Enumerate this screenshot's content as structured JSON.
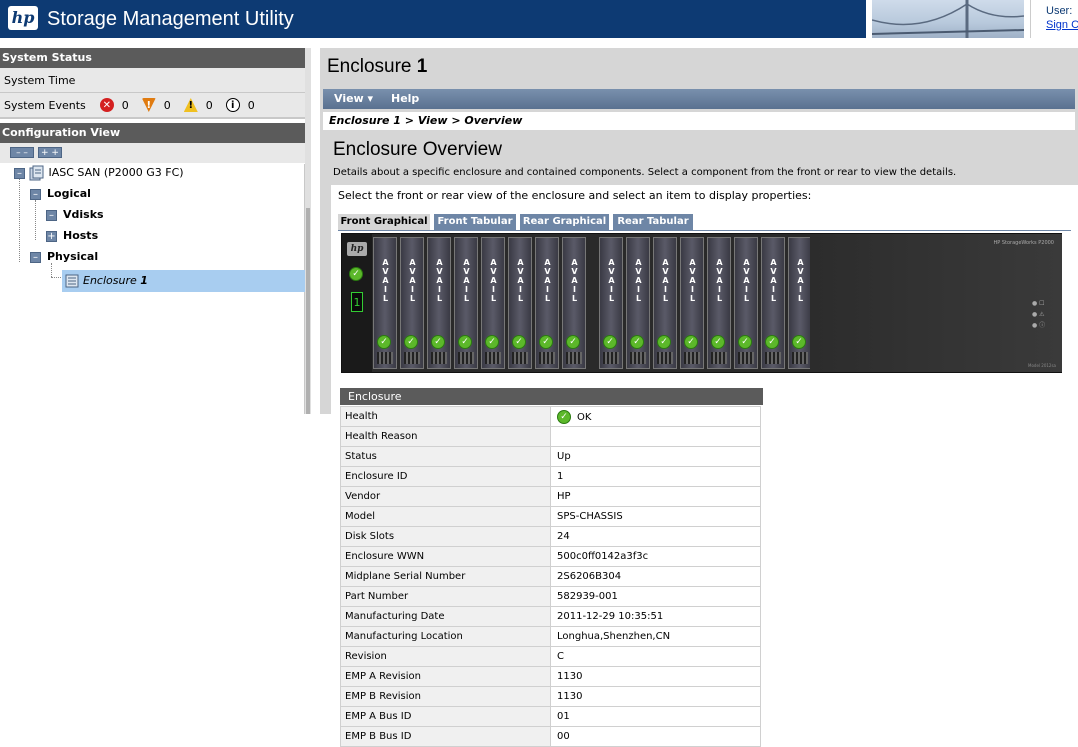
{
  "header": {
    "logo_text": "hp",
    "title": "Storage Management Utility",
    "user_label": "User:",
    "sign_out": "Sign C"
  },
  "system_status": {
    "heading": "System Status",
    "time_label": "System Time",
    "events_label": "System Events",
    "events": [
      {
        "icon": "critical-error-icon",
        "symbol": "✕",
        "color": "#d42020",
        "count": "0"
      },
      {
        "icon": "error-icon",
        "symbol": "!",
        "color": "#e07b10",
        "count": "0"
      },
      {
        "icon": "warning-icon",
        "symbol": "!",
        "color": "#f0c020",
        "count": "0"
      },
      {
        "icon": "info-icon",
        "symbol": "i",
        "color": "#ffffff",
        "count": "0"
      }
    ]
  },
  "config_view": {
    "heading": "Configuration View",
    "collapse_all": "– –",
    "expand_all": "+ +",
    "tree": {
      "root": "IASC SAN (P2000 G3 FC)",
      "logical": "Logical",
      "vdisks": "Vdisks",
      "hosts": "Hosts",
      "physical": "Physical",
      "enclosure_prefix": "Enclosure ",
      "enclosure_num": "1"
    }
  },
  "main": {
    "title_prefix": "Enclosure ",
    "title_num": "1",
    "menu": {
      "view": "View ▾",
      "help": "Help"
    },
    "breadcrumb": "Enclosure 1 > View > Overview",
    "overview_title": "Enclosure Overview",
    "overview_desc": "Details about a specific enclosure and contained components. Select a component from the front or rear to view the details.",
    "instruction": "Select the front or rear view of the enclosure and select an item to display properties:",
    "tabs": [
      "Front Graphical",
      "Front Tabular",
      "Rear Graphical",
      "Rear Tabular"
    ],
    "active_tab": 0
  },
  "enclosure_graphic": {
    "ear_logo": "hp",
    "enclosure_number": "1",
    "drive_label": "AVAIL",
    "drive_count": 16,
    "brand_text": "HP StorageWorks P2000",
    "model_text": "Model 2012sa"
  },
  "properties": {
    "heading": "Enclosure",
    "rows": [
      {
        "key": "Health",
        "value": "OK",
        "ok_icon": true
      },
      {
        "key": "Health Reason",
        "value": ""
      },
      {
        "key": "Status",
        "value": "Up"
      },
      {
        "key": "Enclosure ID",
        "value": "1"
      },
      {
        "key": "Vendor",
        "value": "HP"
      },
      {
        "key": "Model",
        "value": "SPS-CHASSIS"
      },
      {
        "key": "Disk Slots",
        "value": "24"
      },
      {
        "key": "Enclosure WWN",
        "value": "500c0ff0142a3f3c"
      },
      {
        "key": "Midplane Serial Number",
        "value": "2S6206B304"
      },
      {
        "key": "Part Number",
        "value": "582939-001"
      },
      {
        "key": "Manufacturing Date",
        "value": "2011-12-29 10:35:51"
      },
      {
        "key": "Manufacturing Location",
        "value": "Longhua,Shenzhen,CN"
      },
      {
        "key": "Revision",
        "value": "C"
      },
      {
        "key": "EMP A Revision",
        "value": "1130"
      },
      {
        "key": "EMP B Revision",
        "value": "1130"
      },
      {
        "key": "EMP A Bus ID",
        "value": "01"
      },
      {
        "key": "EMP B Bus ID",
        "value": "00"
      }
    ]
  }
}
